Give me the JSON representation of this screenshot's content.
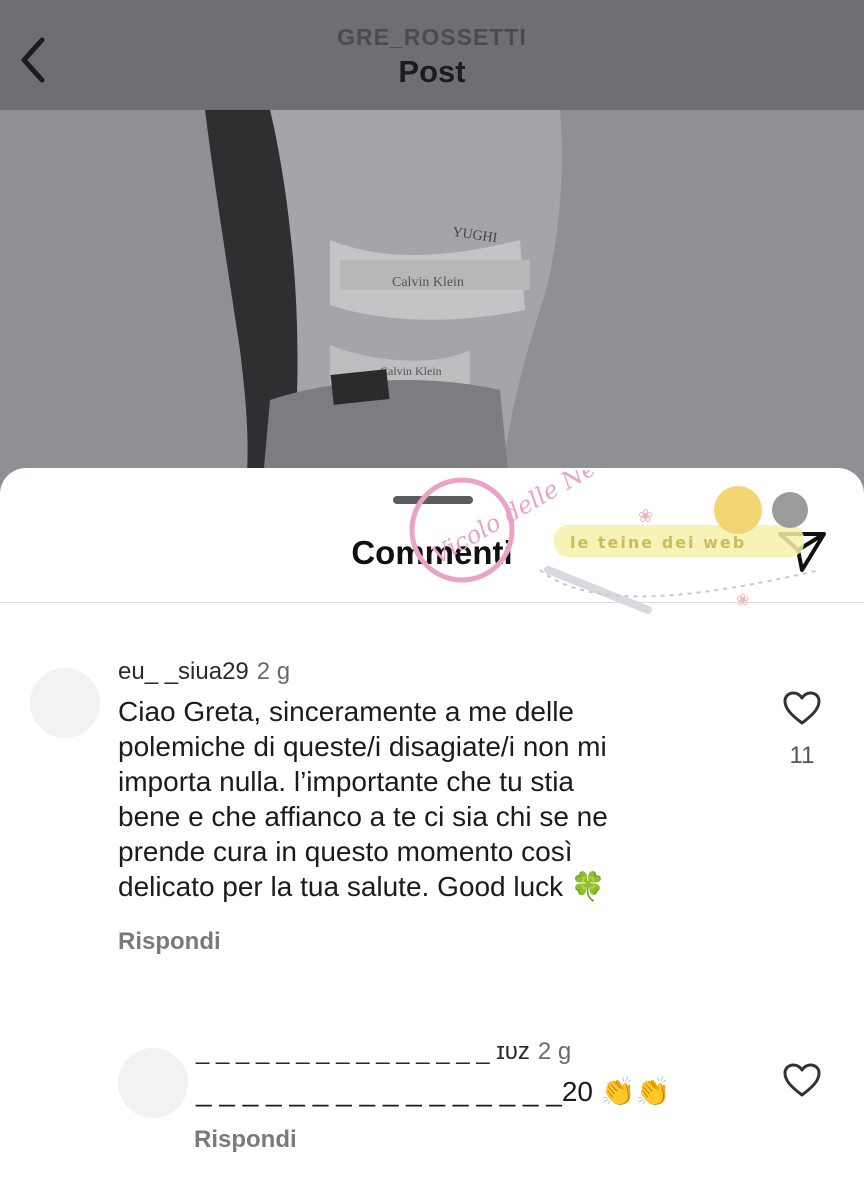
{
  "header": {
    "username": "GRE_ROSSETTI",
    "title": "Post",
    "back_icon": "chevron-left-icon"
  },
  "photo": {
    "tattoo_text": "YUGHI",
    "brand_waistband_1": "Calvin Klein",
    "brand_waistband_2": "Calvin Klein"
  },
  "sheet": {
    "title": "Commenti",
    "send_icon": "paper-plane-icon"
  },
  "watermark": {
    "logo_text": "Vicolo delle News",
    "banner_text": "le teine dei web"
  },
  "comments": [
    {
      "username": "eu_ _siua29",
      "time": "2 g",
      "text": "Ciao Greta, sinceramente a me delle\npolemiche di queste/i disagiate/i non mi\nimporta nulla.  l’importante  che tu stia\nbene e che affianco a te ci sia chi se ne\nprende  cura in questo momento così\ndelicato per la tua salute. Good luck 🍀",
      "reply_label": "Rispondi",
      "like_count": "11"
    },
    {
      "username": "_ _ _ _ _ _ _ _ _ _ _ _ _ _ _ ɪᴜᴢ",
      "time": "2 g",
      "text": "_ _ _ _ _ _ _ _ _ _ _ _ _ _ _ _20 👏👏",
      "reply_label": "Rispondi",
      "like_count": ""
    }
  ],
  "colors": {
    "dim_overlay": "#6d6f73",
    "sheet_bg": "#ffffff",
    "reply_gray": "#7a7a7a",
    "watermark_pink": "#e9a3c6"
  }
}
